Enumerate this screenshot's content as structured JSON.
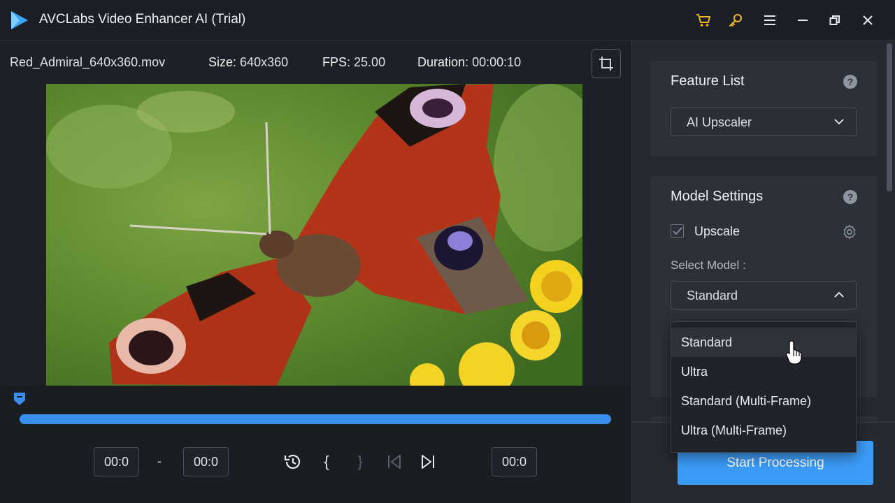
{
  "titlebar": {
    "title": "AVCLabs Video Enhancer AI (Trial)",
    "icons": [
      "app-logo-icon",
      "cart-icon",
      "key-icon",
      "menu-icon",
      "minimize-icon",
      "restore-icon",
      "close-icon"
    ],
    "accent": "#f2b824"
  },
  "file": {
    "name": "Red_Admiral_640x360.mov",
    "size_label": "Size:",
    "size_value": "640x360",
    "fps_label": "FPS:",
    "fps_value": "25.00",
    "duration_label": "Duration:",
    "duration_value": "00:00:10"
  },
  "timeline": {
    "progress": 1.0,
    "start_time": "00:0",
    "separator": "-",
    "end_time": "00:0",
    "current_time": "00:0",
    "color": "#3a8ef0"
  },
  "controls": {
    "icons": [
      "history-icon",
      "mark-in-icon",
      "mark-out-icon",
      "prev-frame-icon",
      "next-frame-icon"
    ],
    "mark_in": "{",
    "mark_out": "}"
  },
  "feature_list": {
    "title": "Feature List",
    "help": "?",
    "selected": "AI Upscaler"
  },
  "model_settings": {
    "title": "Model Settings",
    "help": "?",
    "upscale_label": "Upscale",
    "upscale_checked": true,
    "select_model_label": "Select Model :",
    "selected_model": "Standard",
    "options": [
      "Standard",
      "Ultra",
      "Standard (Multi-Frame)",
      "Ultra (Multi-Frame)"
    ]
  },
  "actions": {
    "start_label": "Start Processing",
    "start_color": "#3b9cf7"
  }
}
